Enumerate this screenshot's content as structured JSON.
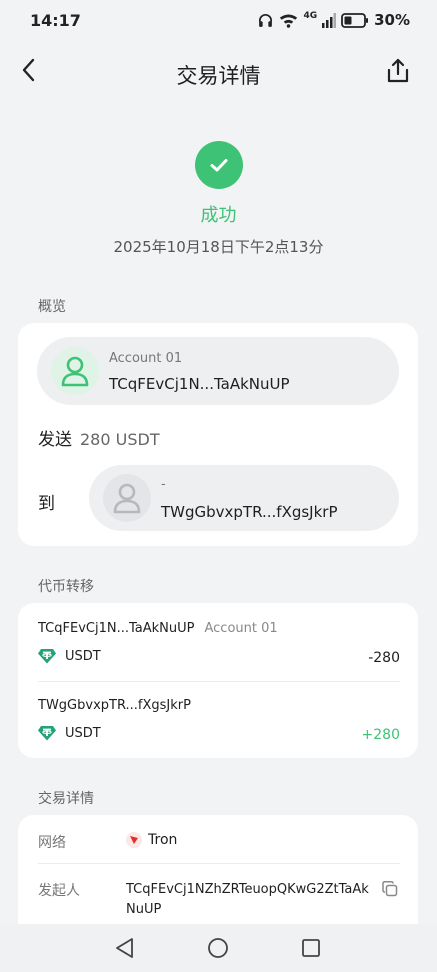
{
  "status_bar": {
    "time": "14:17",
    "network": "4G",
    "battery": "30%"
  },
  "header": {
    "title": "交易详情",
    "back_icon": "back-arrow-icon",
    "share_icon": "share-icon"
  },
  "summary": {
    "status": "成功",
    "datetime": "2025年10月18日下午2点13分",
    "status_color": "#3ec276"
  },
  "overview": {
    "label": "概览",
    "from": {
      "name": "Account 01",
      "address": "TCqFEvCj1N...TaAkNuUP"
    },
    "send_label": "发送",
    "send_amount": "280 USDT",
    "to_label": "到",
    "to": {
      "name": "-",
      "address": "TWgGbvxpTR...fXgsJkrP"
    }
  },
  "token_transfer": {
    "label": "代币转移",
    "rows": [
      {
        "address": "TCqFEvCj1N...TaAkNuUP",
        "account": "Account 01",
        "token": "USDT",
        "amount": "-280"
      },
      {
        "address": "TWgGbvxpTR...fXgsJkrP",
        "account": "",
        "token": "USDT",
        "amount": "+280"
      }
    ],
    "positive_color": "#3ec276"
  },
  "details": {
    "label": "交易详情",
    "network_label": "网络",
    "network_value": "Tron",
    "initiator_label": "发起人",
    "initiator_line1": "TCqFEvCj1NZhZRTeuopQKwG2ZtTaAk",
    "initiator_line2": "NuUP"
  }
}
